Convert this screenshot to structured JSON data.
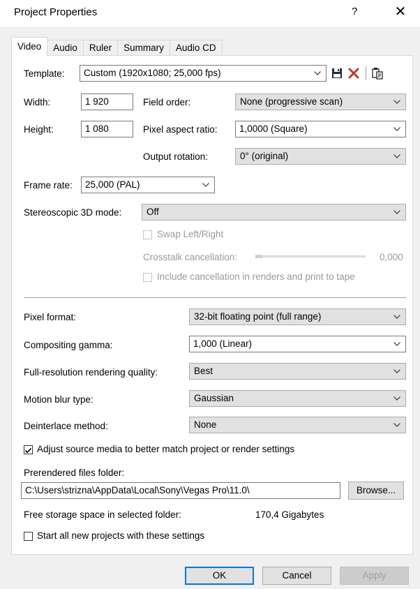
{
  "window": {
    "title": "Project Properties",
    "help": "?",
    "close": "✕"
  },
  "tabs": [
    "Video",
    "Audio",
    "Ruler",
    "Summary",
    "Audio CD"
  ],
  "template": {
    "label": "Template:",
    "value": "Custom (1920x1080; 25,000 fps)"
  },
  "width": {
    "label": "Width:",
    "value": "1 920"
  },
  "height": {
    "label": "Height:",
    "value": "1 080"
  },
  "field_order": {
    "label": "Field order:",
    "value": "None (progressive scan)"
  },
  "pixel_aspect": {
    "label": "Pixel aspect ratio:",
    "value": "1,0000 (Square)"
  },
  "output_rotation": {
    "label": "Output rotation:",
    "value": "0° (original)"
  },
  "frame_rate": {
    "label": "Frame rate:",
    "value": "25,000 (PAL)"
  },
  "stereo": {
    "label": "Stereoscopic 3D mode:",
    "value": "Off",
    "swap_label": "Swap Left/Right",
    "crosstalk_label": "Crosstalk cancellation:",
    "crosstalk_value": "0,000",
    "include_label": "Include cancellation in renders and print to tape"
  },
  "pixel_format": {
    "label": "Pixel format:",
    "value": "32-bit floating point (full range)"
  },
  "compositing_gamma": {
    "label": "Compositing gamma:",
    "value": "1,000 (Linear)"
  },
  "render_quality": {
    "label": "Full-resolution rendering quality:",
    "value": "Best"
  },
  "motion_blur": {
    "label": "Motion blur type:",
    "value": "Gaussian"
  },
  "deinterlace": {
    "label": "Deinterlace method:",
    "value": "None"
  },
  "adjust_source": {
    "label": "Adjust source media to better match project or render settings",
    "checked": true
  },
  "prerendered": {
    "label": "Prerendered files folder:",
    "value": "C:\\Users\\strizna\\AppData\\Local\\Sony\\Vegas Pro\\11.0\\",
    "browse": "Browse..."
  },
  "free_space": {
    "label": "Free storage space in selected folder:",
    "value": "170,4 Gigabytes"
  },
  "start_new": {
    "label": "Start all new projects with these settings",
    "checked": false
  },
  "buttons": {
    "ok": "OK",
    "cancel": "Cancel",
    "apply": "Apply"
  }
}
